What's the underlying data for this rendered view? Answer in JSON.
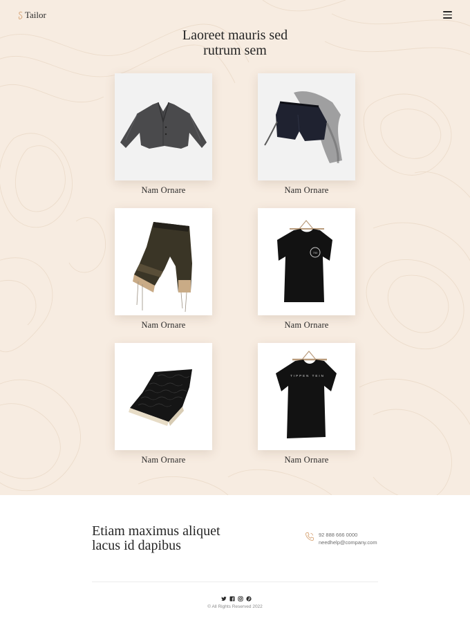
{
  "header": {
    "brand": "Tailor",
    "menu_icon": "hamburger-menu-icon"
  },
  "hero": {
    "title_line1": "Laoreet mauris sed",
    "title_line2": "rutrum sem",
    "products": [
      {
        "label": "Nam Ornare",
        "image": "grey blazer"
      },
      {
        "label": "Nam Ornare",
        "image": "black shorts with sheer scarf"
      },
      {
        "label": "Nam Ornare",
        "image": "dark trousers with beige hem"
      },
      {
        "label": "Nam Ornare",
        "image": "black t-shirt on hanger"
      },
      {
        "label": "Nam Ornare",
        "image": "black knit fabric with beige edge"
      },
      {
        "label": "Nam Ornare",
        "image": "black t-shirt on hanger"
      }
    ]
  },
  "footer": {
    "heading_line1": "Etiam maximus aliquet",
    "heading_line2": "lacus id dapibus",
    "phone": "92 888 666 0000",
    "email": "needhelp@company.com",
    "social_icons": [
      "twitter-icon",
      "facebook-icon",
      "instagram-icon",
      "pinterest-icon"
    ],
    "copyright": "© All Rights Reserved 2022"
  },
  "colors": {
    "hero_background": "#f7ece1",
    "accent": "#d9a77a",
    "text": "#252525"
  }
}
